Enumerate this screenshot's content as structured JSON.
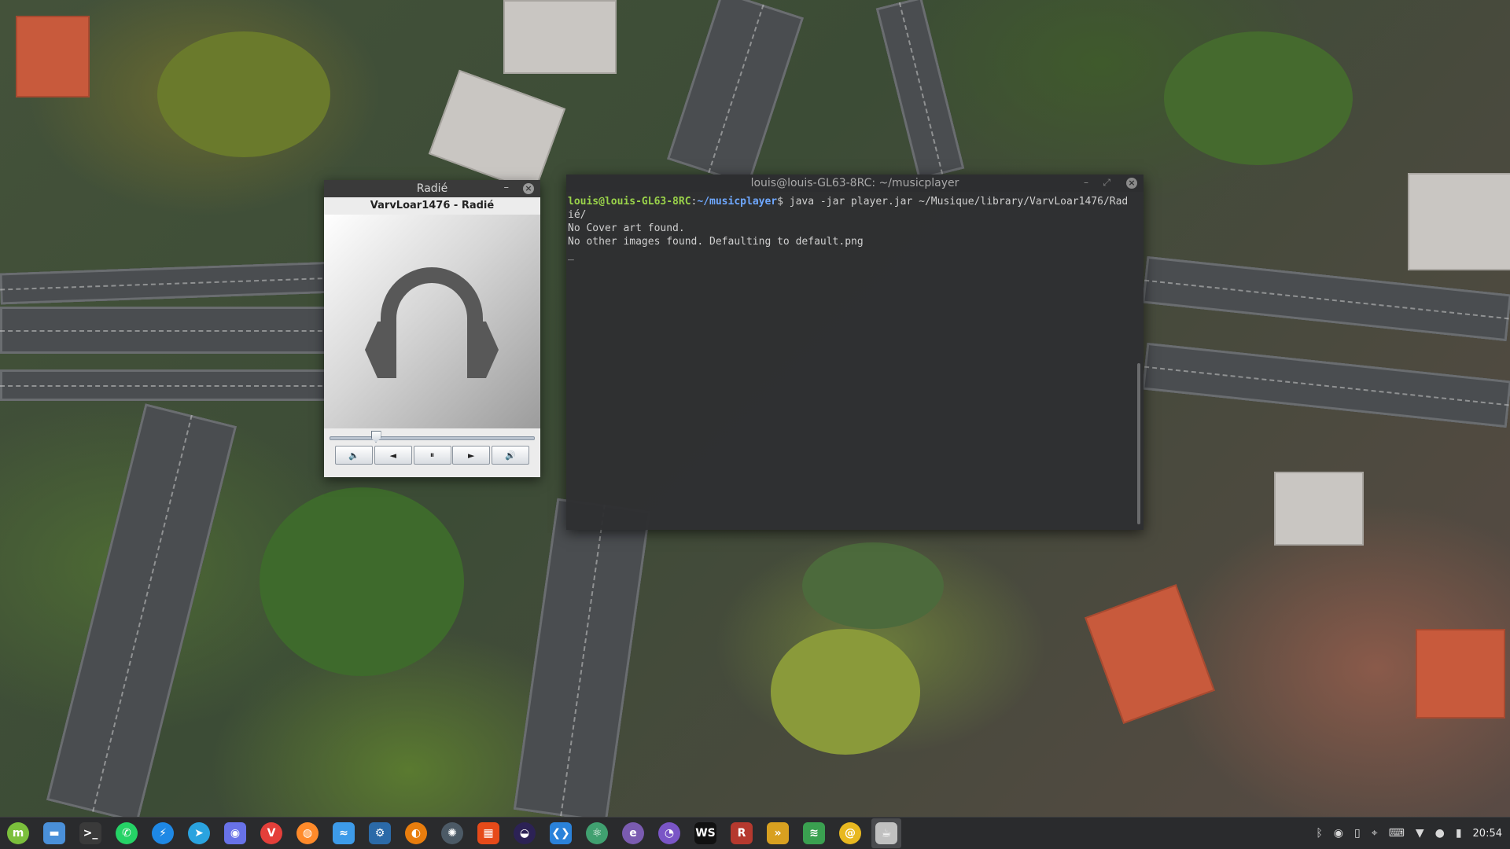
{
  "player": {
    "window_title": "Radié",
    "minimize_glyph": "–",
    "close_glyph": "×",
    "track_title": "VarvLoar1476 - Radié",
    "cover_icon": "headphones-icon",
    "progress": 0.21,
    "controls": [
      {
        "name": "volume-down-button",
        "icon": "speaker-low-icon",
        "glyph": "🔈"
      },
      {
        "name": "previous-button",
        "icon": "previous-icon",
        "glyph": "◄"
      },
      {
        "name": "pause-button",
        "icon": "pause-icon",
        "glyph": "⏸"
      },
      {
        "name": "next-button",
        "icon": "next-icon",
        "glyph": "►"
      },
      {
        "name": "volume-up-button",
        "icon": "speaker-high-icon",
        "glyph": "🔊"
      }
    ]
  },
  "terminal": {
    "window_title": "louis@louis-GL63-8RC: ~/musicplayer",
    "min_glyph": "–",
    "max_glyph": "⤢",
    "close_glyph": "×",
    "prompt_user": "louis@louis-GL63-8RC",
    "prompt_sep": ":",
    "prompt_path": "~/musicplayer",
    "prompt_symbol": "$ ",
    "command": "java -jar player.jar ~/Musique/library/VarvLoar1476/Radié/",
    "output": [
      "No Cover art found.",
      "No other images found. Defaulting to default.png"
    ],
    "cursor": "_"
  },
  "taskbar": {
    "apps": [
      {
        "name": "mint-menu",
        "icon": "linux-mint-icon",
        "glyph": "m",
        "color": "#7bbf3c",
        "round": true
      },
      {
        "name": "files",
        "icon": "folder-icon",
        "glyph": "▬",
        "color": "#4a90d9"
      },
      {
        "name": "terminal",
        "icon": "terminal-icon",
        "glyph": ">_",
        "color": "#3a3a3a"
      },
      {
        "name": "whatsapp",
        "icon": "whatsapp-icon",
        "glyph": "✆",
        "color": "#25d366",
        "round": true
      },
      {
        "name": "messenger",
        "icon": "messenger-icon",
        "glyph": "⚡",
        "color": "#1e88e5",
        "round": true
      },
      {
        "name": "telegram",
        "icon": "telegram-icon",
        "glyph": "➤",
        "color": "#2aa3df",
        "round": true
      },
      {
        "name": "discord",
        "icon": "discord-icon",
        "glyph": "◉",
        "color": "#6872e8"
      },
      {
        "name": "vivaldi",
        "icon": "vivaldi-icon",
        "glyph": "V",
        "color": "#e43f3a",
        "round": true
      },
      {
        "name": "firefox",
        "icon": "firefox-icon",
        "glyph": "◍",
        "color": "#ff8a2a",
        "round": true
      },
      {
        "name": "dolphin",
        "icon": "dolphin-icon",
        "glyph": "≈",
        "color": "#3d9be9"
      },
      {
        "name": "steam",
        "icon": "steam-icon",
        "glyph": "⚙",
        "color": "#2b6aa8"
      },
      {
        "name": "blender",
        "icon": "blender-icon",
        "glyph": "◐",
        "color": "#e87d0d",
        "round": true
      },
      {
        "name": "davinci-resolve",
        "icon": "davinci-resolve-icon",
        "glyph": "✺",
        "color": "#4c5a66",
        "round": true
      },
      {
        "name": "office",
        "icon": "office-icon",
        "glyph": "▦",
        "color": "#e64a19"
      },
      {
        "name": "eclipse",
        "icon": "eclipse-icon",
        "glyph": "◒",
        "color": "#2c2255",
        "round": true
      },
      {
        "name": "vscode",
        "icon": "vscode-icon",
        "glyph": "❮❯",
        "color": "#2a82da"
      },
      {
        "name": "atom",
        "icon": "atom-icon",
        "glyph": "⚛",
        "color": "#40a070",
        "round": true
      },
      {
        "name": "emacs",
        "icon": "emacs-icon",
        "glyph": "e",
        "color": "#7a5bb0",
        "round": true
      },
      {
        "name": "github-desktop",
        "icon": "github-icon",
        "glyph": "◔",
        "color": "#7a55c6",
        "round": true
      },
      {
        "name": "webstorm",
        "icon": "webstorm-icon",
        "glyph": "WS",
        "color": "#111111"
      },
      {
        "name": "rider",
        "icon": "rider-icon",
        "glyph": "R",
        "color": "#b5392e"
      },
      {
        "name": "arrow-app",
        "icon": "arrow-icon",
        "glyph": "»",
        "color": "#d8a020"
      },
      {
        "name": "layers-app",
        "icon": "layers-icon",
        "glyph": "≋",
        "color": "#3aa050"
      },
      {
        "name": "spiral-app",
        "icon": "spiral-icon",
        "glyph": "@",
        "color": "#e8b820",
        "round": true
      },
      {
        "name": "music-player",
        "icon": "java-icon",
        "glyph": "☕",
        "color": "#c0c0c0",
        "active": true
      }
    ],
    "tray": [
      {
        "name": "bluetooth",
        "icon": "bluetooth-icon",
        "glyph": "ᛒ"
      },
      {
        "name": "discord-tray",
        "icon": "discord-icon",
        "glyph": "◉"
      },
      {
        "name": "phone",
        "icon": "phone-icon",
        "glyph": "▯"
      },
      {
        "name": "location",
        "icon": "location-pin-icon",
        "glyph": "⌖"
      },
      {
        "name": "keyboard",
        "icon": "keyboard-icon",
        "glyph": "⌨"
      },
      {
        "name": "wifi",
        "icon": "wifi-icon",
        "glyph": "▼"
      },
      {
        "name": "update",
        "icon": "shield-icon",
        "glyph": "●"
      },
      {
        "name": "battery",
        "icon": "battery-icon",
        "glyph": "▮"
      }
    ],
    "clock": "20:54"
  }
}
